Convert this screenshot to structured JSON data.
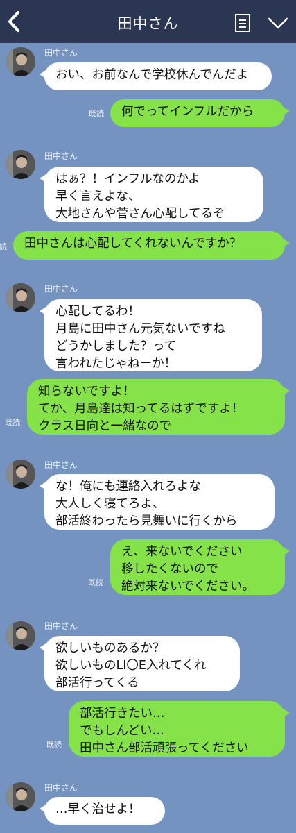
{
  "header": {
    "title": "田中さん"
  },
  "colors": {
    "background": "#7493c0",
    "header": "#2b3752",
    "incoming": "#ffffff",
    "outgoing": "#85e249"
  },
  "read_label": "既読",
  "messages": [
    {
      "from": "田中さん",
      "lines": [
        "おい、お前なんで学校休んでんだよ"
      ]
    },
    {
      "from": "me",
      "lines": [
        "何でってインフルだから"
      ]
    },
    {
      "from": "田中さん",
      "lines": [
        "はぁ？！インフルなのかよ",
        "早く言えよな、",
        "大地さんや菅さん心配してるぞ"
      ]
    },
    {
      "from": "me",
      "lines": [
        "田中さんは心配してくれないんですか？"
      ]
    },
    {
      "from": "田中さん",
      "lines": [
        "心配してるわ！",
        "月島に田中さん元気ないですね",
        "どうかしました？って",
        "言われたじゃねーか！"
      ]
    },
    {
      "from": "me",
      "lines": [
        "知らないですよ！",
        "てか、月島達は知ってるはずですよ！",
        "クラス日向と一緒なので"
      ]
    },
    {
      "from": "田中さん",
      "lines": [
        "な！俺にも連絡入れろよな",
        "大人しく寝てろよ、",
        "部活終わったら見舞いに行くから"
      ]
    },
    {
      "from": "me",
      "lines": [
        "え、来ないでください",
        "移したくないので",
        "絶対来ないでください。"
      ]
    },
    {
      "from": "田中さん",
      "lines": [
        "欲しいものあるか？",
        "欲しいものLI〇E入れてくれ",
        "部活行ってくる"
      ]
    },
    {
      "from": "me",
      "lines": [
        "部活行きたい…",
        "でもしんどい…",
        "田中さん部活頑張ってください"
      ]
    },
    {
      "from": "田中さん",
      "lines": [
        "…早く治せよ！"
      ]
    }
  ]
}
